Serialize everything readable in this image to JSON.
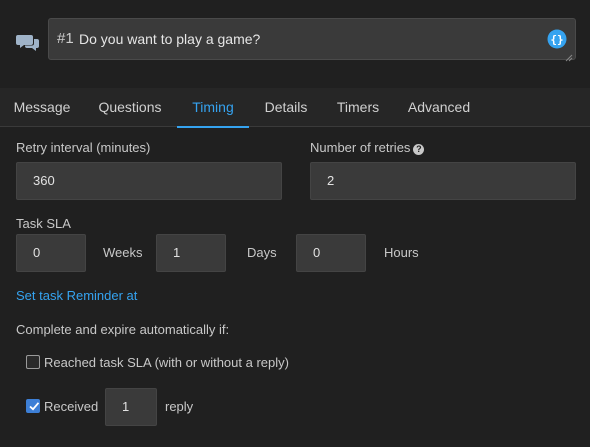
{
  "message": {
    "number": "#1",
    "text": "Do you want to play a game?"
  },
  "tabs": [
    {
      "label": "Message",
      "active": false
    },
    {
      "label": "Questions",
      "active": false
    },
    {
      "label": "Timing",
      "active": true
    },
    {
      "label": "Details",
      "active": false
    },
    {
      "label": "Timers",
      "active": false
    },
    {
      "label": "Advanced",
      "active": false
    }
  ],
  "timing": {
    "retry_interval_label": "Retry interval (minutes)",
    "retry_interval_value": "360",
    "retries_label": "Number of retries",
    "retries_value": "2",
    "task_sla_label": "Task SLA",
    "weeks_value": "0",
    "weeks_label": "Weeks",
    "days_value": "1",
    "days_label": "Days",
    "hours_value": "0",
    "hours_label": "Hours",
    "reminder_link": "Set task Reminder at",
    "auto_complete_label": "Complete and expire automatically if:",
    "option_sla_label": "Reached task SLA (with or without a reply)",
    "option_sla_checked": false,
    "option_received_label": "Received",
    "option_received_checked": true,
    "received_count": "1",
    "reply_label": "reply"
  },
  "colors": {
    "accent": "#35a3f0",
    "background": "#202020",
    "field": "#3a3a3a"
  },
  "icons": {
    "chat": "chat-bubbles-icon",
    "variable": "variable-braces-icon",
    "help": "question-circle-icon"
  }
}
